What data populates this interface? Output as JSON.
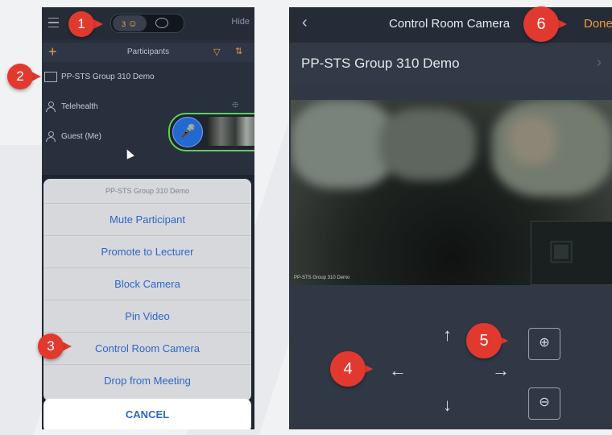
{
  "left_screen": {
    "header": {
      "participant_count": "3",
      "hide_label": "Hide"
    },
    "participants_bar": {
      "title": "Participants"
    },
    "participants": [
      {
        "name": "PP-STS Group 310 Demo",
        "icon": "room-icon"
      },
      {
        "name": "Telehealth",
        "icon": "person-icon"
      },
      {
        "name": "Guest (Me)",
        "icon": "person-icon"
      }
    ],
    "action_sheet": {
      "title": "PP-STS Group 310 Demo",
      "items": [
        "Mute Participant",
        "Promote to Lecturer",
        "Block Camera",
        "Pin Video",
        "Control Room Camera",
        "Drop from Meeting"
      ],
      "cancel_label": "CANCEL"
    }
  },
  "right_screen": {
    "nav": {
      "title": "Control Room Camera",
      "done_label": "Done"
    },
    "room_name": "PP-STS Group 310 Demo",
    "video_label": "PP-STS Group 310 Demo",
    "controls": {
      "up": "↑",
      "down": "↓",
      "left": "←",
      "right": "→",
      "zoom_in": "⊕",
      "zoom_out": "⊖"
    }
  },
  "callouts": [
    "1",
    "2",
    "3",
    "4",
    "5",
    "6"
  ],
  "colors": {
    "callout_red": "#e2392f",
    "accent_orange": "#f29a38",
    "sheet_blue": "#2e66c7",
    "active_green": "#5fcf5a",
    "mic_blue": "#2468d1"
  }
}
